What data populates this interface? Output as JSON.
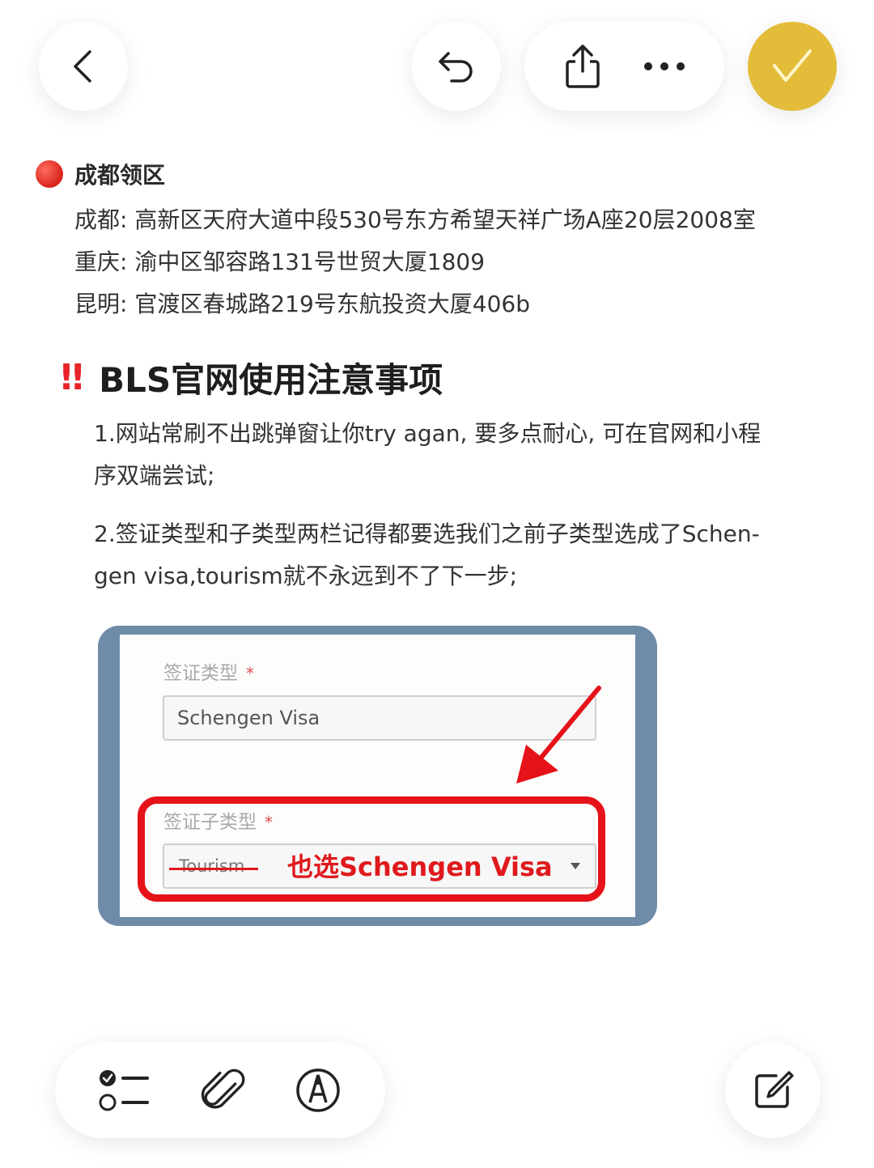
{
  "toolbar": {
    "icons": [
      "chevron-left-icon",
      "undo-icon",
      "share-icon",
      "more-icon",
      "check-icon"
    ],
    "accent_color": "#e3bc3a"
  },
  "note": {
    "region": {
      "title": "成都领区",
      "addresses": [
        "成都: 高新区天府大道中段530号东方希望天祥广场A座20层2008室",
        "重庆: 渝中区邹容路131号世贸大厦1809",
        "昆明: 官渡区春城路219号东航投资大厦406b"
      ]
    },
    "heading": {
      "mark": "!!",
      "text": "BLS官网使用注意事项"
    },
    "paragraphs": [
      "1.网站常刷不出跳弹窗让你try   agan, 要多点耐心, 可在官网和小程序双端尝试;",
      "2.签证类型和子类型两栏记得都要选我们之前子类型选成了Schen-gen visa,tourism就不永远到不了下一步;"
    ],
    "embedded_image": {
      "visa_type_label": "签证类型",
      "required_mark": "*",
      "visa_type_value": "Schengen Visa",
      "visa_subtype_label": "签证子类型",
      "visa_subtype_value_struck": "Tourism",
      "annotation": "也选Schengen Visa"
    }
  },
  "bottom_bar": {
    "icons": [
      "checklist-icon",
      "paperclip-icon",
      "pen-icon",
      "edit-icon"
    ]
  }
}
